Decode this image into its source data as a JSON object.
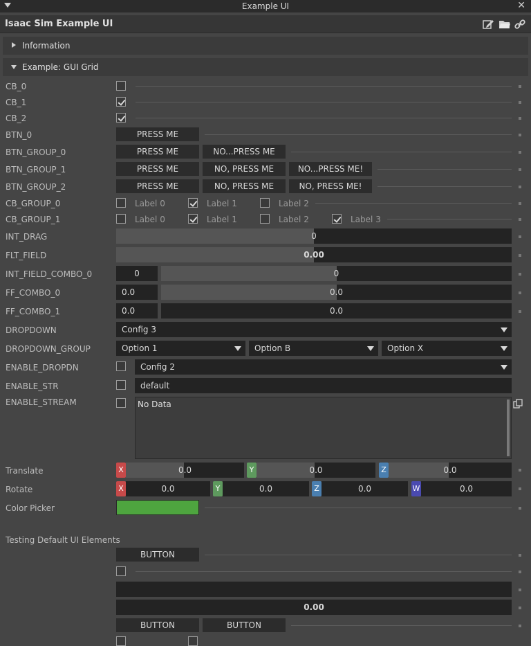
{
  "window": {
    "title": "Example UI"
  },
  "app": {
    "title": "Isaac Sim Example UI"
  },
  "sections": {
    "info": "Information",
    "grid": "Example: GUI Grid"
  },
  "rows": {
    "cb0": "CB_0",
    "cb1": "CB_1",
    "cb2": "CB_2",
    "btn0": "BTN_0",
    "btng0": "BTN_GROUP_0",
    "btng1": "BTN_GROUP_1",
    "btng2": "BTN_GROUP_2",
    "cbg0": "CB_GROUP_0",
    "cbg1": "CB_GROUP_1",
    "intdrag": "INT_DRAG",
    "fltfield": "FLT_FIELD",
    "ifcombo0": "INT_FIELD_COMBO_0",
    "ffcombo0": "FF_COMBO_0",
    "ffcombo1": "FF_COMBO_1",
    "dropdown": "DROPDOWN",
    "dropdowngroup": "DROPDOWN_GROUP",
    "enabledropdn": "ENABLE_DROPDN",
    "enablestr": "ENABLE_STR",
    "enablestream": "ENABLE_STREAM",
    "translate": "Translate",
    "rotate": "Rotate",
    "colorpicker": "Color Picker"
  },
  "checks": {
    "cb0": false,
    "cb1": true,
    "cb2": true
  },
  "buttons": {
    "press_me": "PRESS ME",
    "no_press_me_ellipsis": "NO...PRESS ME",
    "no_press_me_bang_ellipsis": "NO...PRESS ME!",
    "no_press_me": "NO, PRESS ME",
    "no_press_me_bang": "NO, PRESS ME!"
  },
  "cb_group_0": [
    {
      "label": "Label 0",
      "checked": false
    },
    {
      "label": "Label 1",
      "checked": true
    },
    {
      "label": "Label 2",
      "checked": false
    }
  ],
  "cb_group_1": [
    {
      "label": "Label 0",
      "checked": false
    },
    {
      "label": "Label 1",
      "checked": true
    },
    {
      "label": "Label 2",
      "checked": false
    },
    {
      "label": "Label 3",
      "checked": true
    }
  ],
  "values": {
    "int_drag": "0",
    "int_drag_fraction": 0.5,
    "flt_field": "0.00",
    "flt_field_fraction": 0.5,
    "ifcombo_field": "0",
    "ifcombo_slider": "0",
    "ifcombo_fraction": 0.5,
    "ffcombo0_field": "0.0",
    "ffcombo0_slider": "0.0",
    "ffcombo0_fraction": 0.5,
    "ffcombo1_field": "0.0",
    "ffcombo1_slider": "0.0",
    "ffcombo1_fraction": 0.0
  },
  "dropdown": {
    "selected": "Config 3"
  },
  "dropdown_group": [
    "Option 1",
    "Option B",
    "Option X"
  ],
  "enable_dropdn": {
    "checked": false,
    "selected": "Config 2"
  },
  "enable_str": {
    "checked": false,
    "value": "default"
  },
  "enable_stream": {
    "checked": false,
    "text": "No Data"
  },
  "translate": {
    "x_label": "X",
    "y_label": "Y",
    "z_label": "Z",
    "x": "0.0",
    "y": "0.0",
    "z": "0.0"
  },
  "rotate": {
    "x_label": "X",
    "y_label": "Y",
    "z_label": "Z",
    "w_label": "W",
    "x": "0.0",
    "y": "0.0",
    "z": "0.0",
    "w": "0.0"
  },
  "color_picker": {
    "color": "#4ea53f"
  },
  "defaults": {
    "heading": "Testing Default UI Elements",
    "button": "BUTTON",
    "float_value": "0.00"
  },
  "colors": {
    "axis_x": "#c74a4a",
    "axis_y": "#5e9a5e",
    "axis_z": "#4a7fb0",
    "axis_w": "#4a4ab0"
  }
}
